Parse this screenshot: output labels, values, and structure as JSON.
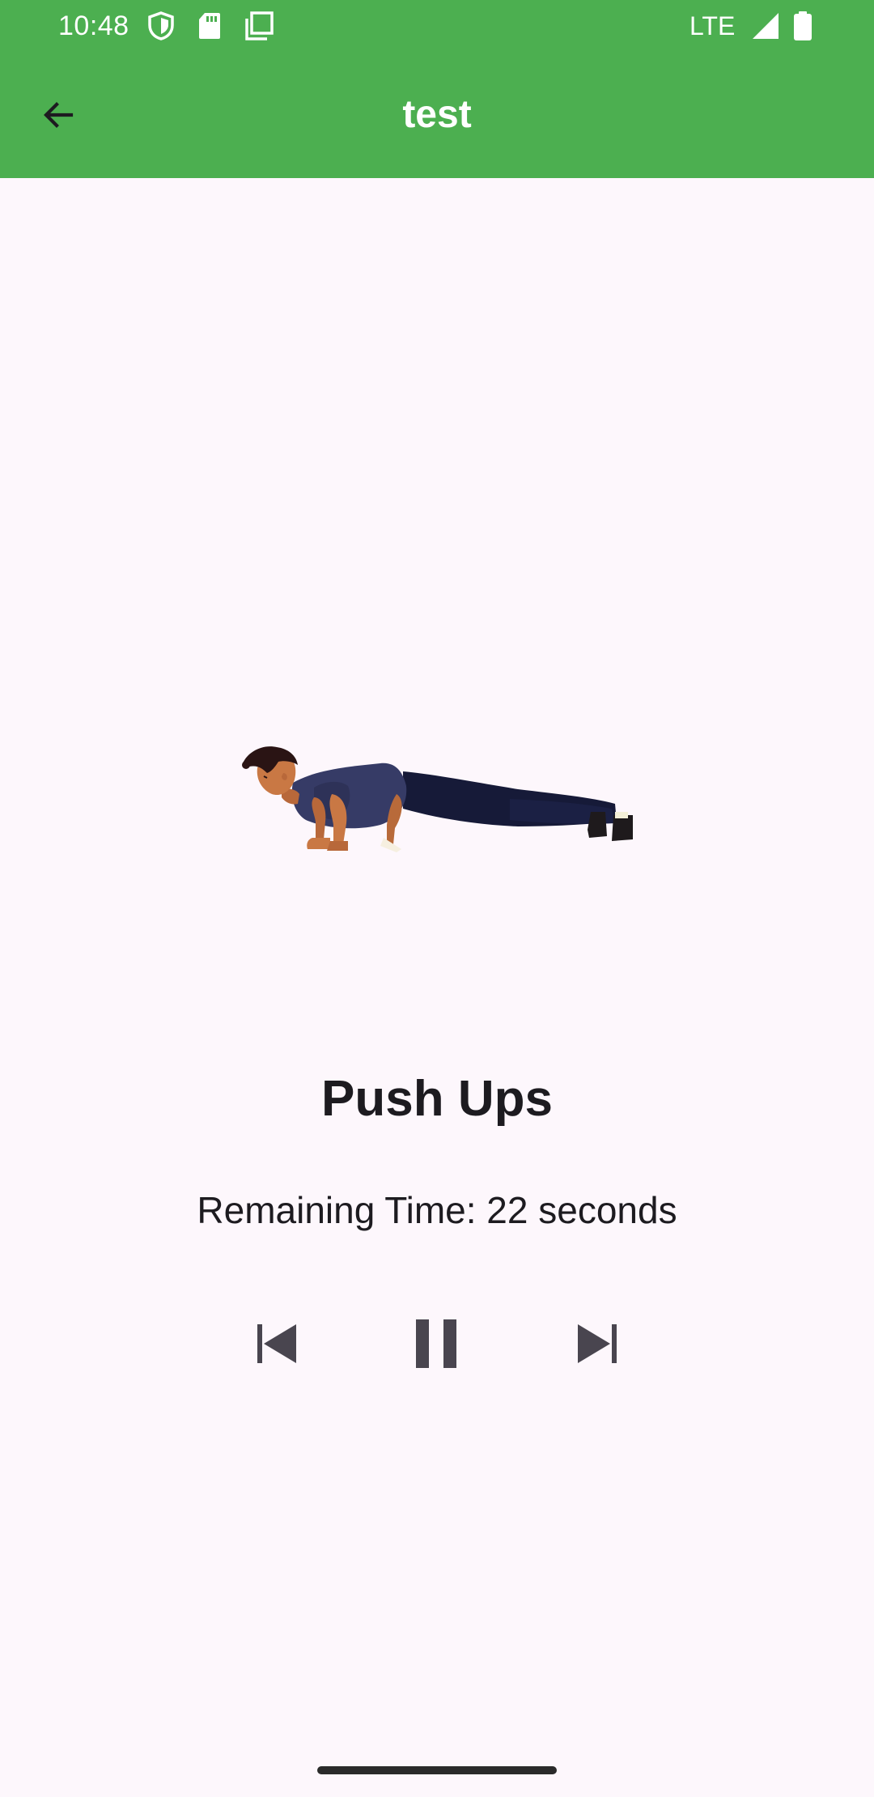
{
  "status_bar": {
    "time": "10:48",
    "network": "LTE",
    "icons": [
      "shield-icon",
      "sd-card-icon",
      "screenshot-icon",
      "signal-icon",
      "battery-icon"
    ]
  },
  "app_bar": {
    "title": "test",
    "back_icon": "arrow-back-icon",
    "background": "#4caf50"
  },
  "exercise": {
    "name": "Push Ups",
    "remaining_time_text": "Remaining Time: 22 seconds",
    "illustration": "push-up-man-illustration"
  },
  "controls": {
    "previous_icon": "skip-previous-icon",
    "pause_icon": "pause-icon",
    "next_icon": "skip-next-icon",
    "color": "#49454f"
  }
}
